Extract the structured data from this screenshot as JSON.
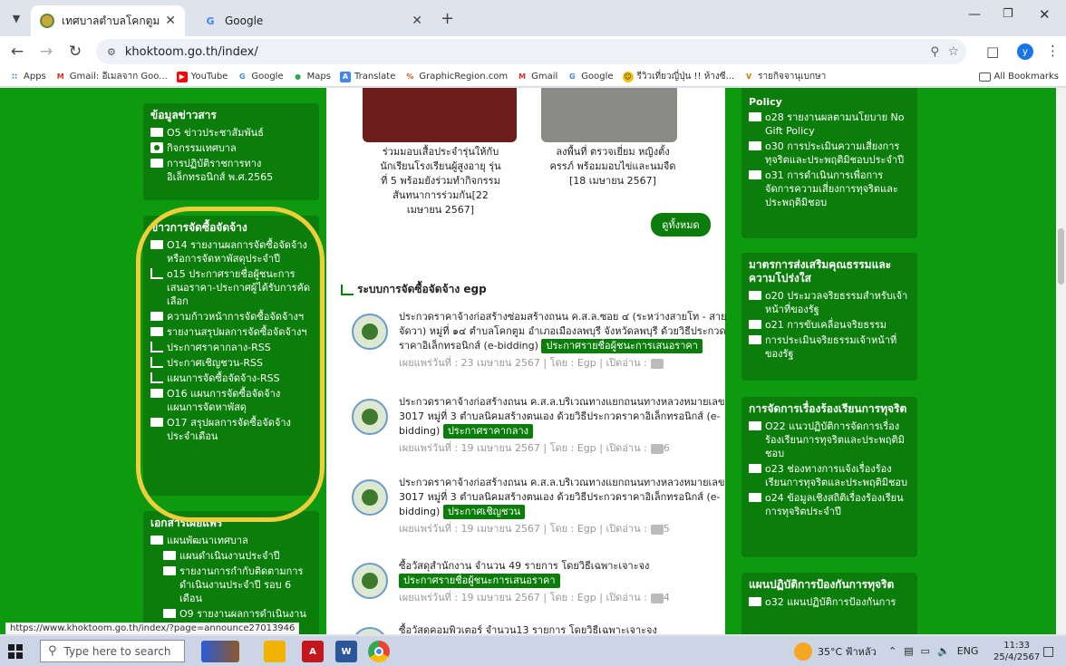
{
  "browser": {
    "tabs": [
      {
        "title": "เทศบาลตำบลโคกตูม อำเภอเมืองลพบ",
        "favicon": "site-seal-icon"
      },
      {
        "title": "Google",
        "favicon": "google-g-icon"
      }
    ],
    "url": "khoktoom.go.th/index/",
    "bookmarks": [
      {
        "label": "Apps",
        "icon": "apps-grid-icon"
      },
      {
        "label": "Gmail: อีเมลจาก Goo...",
        "icon": "gmail-icon"
      },
      {
        "label": "YouTube",
        "icon": "youtube-icon"
      },
      {
        "label": "Google",
        "icon": "google-g-icon"
      },
      {
        "label": "Maps",
        "icon": "maps-pin-icon"
      },
      {
        "label": "Translate",
        "icon": "translate-icon"
      },
      {
        "label": "GraphicRegion.com",
        "icon": "graphicregion-icon"
      },
      {
        "label": "Gmail",
        "icon": "gmail-icon"
      },
      {
        "label": "Google",
        "icon": "google-g-icon"
      },
      {
        "label": "รีวิวเที่ยวญี่ปุ่น !! ห้างซี...",
        "icon": "emoji-icon"
      },
      {
        "label": "รายกิจจานุเบกษา",
        "icon": "v-icon"
      }
    ],
    "all_bookmarks": "All Bookmarks"
  },
  "left_boxes": [
    {
      "title": "ข้อมูลข่าวสาร",
      "items": [
        {
          "icon": "folder-icon",
          "label": "O5 ข่าวประชาสัมพันธ์"
        },
        {
          "icon": "camera-icon",
          "label": "กิจกรรมเทศบาล"
        },
        {
          "icon": "folder-icon",
          "label": "การปฏิบัติราชการทางอิเล็กทรอนิกส์ พ.ศ.2565"
        }
      ]
    },
    {
      "title": "ข่าวการจัดซื้อจัดจ้าง",
      "items": [
        {
          "icon": "folder-icon",
          "label": "O14 รายงานผลการจัดซื้อจัดจ้างหรือการจัดหาพัสดุประจำปี"
        },
        {
          "icon": "rss-icon",
          "label": "o15 ประกาศรายชื่อผู้ชนะการเสนอราคา-ประกาศผู้ได้รับการคัดเลือก"
        },
        {
          "icon": "folder-icon",
          "label": "ความก้าวหน้าการจัดซื้อจัดจ้างฯ"
        },
        {
          "icon": "folder-icon",
          "label": "รายงานสรุปผลการจัดซื้อจัดจ้างฯ"
        },
        {
          "icon": "rss-icon",
          "label": "ประกาศราคากลาง-RSS"
        },
        {
          "icon": "rss-icon",
          "label": "ประกาศเชิญชวน-RSS"
        },
        {
          "icon": "rss-icon",
          "label": "แผนการจัดซื้อจัดจ้าง-RSS"
        },
        {
          "icon": "folder-icon",
          "label": "O16 แผนการจัดซื้อจัดจ้างแผนการจัดหาพัสดุ"
        },
        {
          "icon": "folder-icon",
          "label": "O17 สรุปผลการจัดซื้อจัดจ้างประจำเดือน"
        }
      ]
    },
    {
      "title": "เอกสารเผยแพร่",
      "items": [
        {
          "icon": "folder-icon",
          "label": "แผนพัฒนาเทศบาล",
          "indent": false
        },
        {
          "icon": "folder-icon",
          "label": "แผนดำเนินงานประจำปี",
          "indent": true
        },
        {
          "icon": "folder-icon",
          "label": "รายงานการกำกับติดตามการดำเนินงานประจำปี รอบ 6 เดือน",
          "indent": true
        },
        {
          "icon": "folder-icon",
          "label": "O9 รายงานผลการดำเนินงาน",
          "indent": false
        }
      ]
    }
  ],
  "news": [
    {
      "caption": "ร่วมมอบเสื้อประจำรุ่นให้กับนักเรียนโรงเรียนผู้สูงอายุ รุ่นที่ 5 พร้อมยังร่วมทำกิจกรรมสันทนาการร่วมกัน[22 เมษายน 2567]"
    },
    {
      "caption": "ลงพื้นที่ ตรวจเยี่ยม หญิงตั้งครรภ์ พร้อมมอบไข่และนมจืด [18 เมษายน 2567]"
    }
  ],
  "view_all": "ดูทั้งหมด",
  "egp": {
    "heading": "ระบบการจัดซื้อจัดจ้าง egp",
    "items": [
      {
        "title": "ประกวดราคาจ้างก่อสร้างซ่อมสร้างถนน ค.ส.ล.ซอย ๔ (ระหว่างสายโท - สายจัดวา) หมู่ที่ ๑๔ ตำบลโคกตูม อำเภอเมืองลพบุรี จังหวัดลพบุรี ด้วยวิธีประกวดราคาอิเล็กทรอนิกส์ (e-bidding)",
        "tag": "ประกาศรายชื่อผู้ชนะการเสนอราคา",
        "meta": "เผยแพร่วันที่ : 23 เมษายน 2567 | โดย : Egp | เปิดอ่าน :",
        "views": ""
      },
      {
        "title": "ประกวดราคาจ้างก่อสร้างถนน ค.ส.ล.บริเวณทางแยกถนนทางหลวงหมายเลข 3017 หมู่ที่ 3 ตำบลนิคมสร้างตนเอง ด้วยวิธีประกวดราคาอิเล็กทรอนิกส์ (e-bidding)",
        "tag": "ประกาศราคากลาง",
        "meta": "เผยแพร่วันที่ : 19 เมษายน 2567 | โดย : Egp | เปิดอ่าน :",
        "views": "6"
      },
      {
        "title": "ประกวดราคาจ้างก่อสร้างถนน ค.ส.ล.บริเวณทางแยกถนนทางหลวงหมายเลข 3017 หมู่ที่ 3 ตำบลนิคมสร้างตนเอง ด้วยวิธีประกวดราคาอิเล็กทรอนิกส์ (e-bidding)",
        "tag": "ประกาศเชิญชวน",
        "meta": "เผยแพร่วันที่ : 19 เมษายน 2567 | โดย : Egp | เปิดอ่าน :",
        "views": "5"
      },
      {
        "title": "ซื้อวัสดุสำนักงาน จำนวน 49 รายการ โดยวิธีเฉพาะเจาะจง",
        "tag": "ประกาศรายชื่อผู้ชนะการเสนอราคา",
        "meta": "เผยแพร่วันที่ : 19 เมษายน 2567 | โดย : Egp | เปิดอ่าน :",
        "views": "4"
      },
      {
        "title": "ซื้อวัสดุคอมพิวเตอร์ จำนวน13 รายการ โดยวิธีเฉพาะเจาะจง",
        "tag": "",
        "meta": "",
        "views": ""
      }
    ]
  },
  "right_boxes": [
    {
      "title": "",
      "items": [
        {
          "icon": "",
          "label": "Policy"
        },
        {
          "icon": "folder-icon",
          "label": "o28 รายงานผลตามนโยบาย No Gift Policy"
        },
        {
          "icon": "folder-icon",
          "label": "o30 การประเมินความเสี่ยงการทุจริตและประพฤติมิชอบประจำปี"
        },
        {
          "icon": "folder-icon",
          "label": "o31 การดำเนินการเพื่อการจัดการความเสี่ยงการทุจริตและประพฤติมิชอบ"
        }
      ]
    },
    {
      "title": "มาตรการส่งเสริมคุณธรรมและความโปร่งใส",
      "items": [
        {
          "icon": "folder-icon",
          "label": "o20 ประมวลจริยธรรมสำหรับเจ้าหน้าที่ของรัฐ"
        },
        {
          "icon": "folder-icon",
          "label": "o21 การขับเคลื่อนจริยธรรม"
        },
        {
          "icon": "folder-icon",
          "label": "การประเมินจริยธรรมเจ้าหน้าที่ของรัฐ"
        }
      ]
    },
    {
      "title": "การจัดการเรื่องร้องเรียนการทุจริต",
      "items": [
        {
          "icon": "folder-icon",
          "label": "O22 แนวปฏิบัติการจัดการเรื่องร้องเรียนการทุจริตและประพฤติมิชอบ"
        },
        {
          "icon": "folder-icon",
          "label": "o23 ช่องทางการแจ้งเรื่องร้องเรียนการทุจริตและประพฤติมิชอบ"
        },
        {
          "icon": "folder-icon",
          "label": "o24 ข้อมูลเชิงสถิติเรื่องร้องเรียนการทุจริตประจำปี"
        }
      ]
    },
    {
      "title": "แผนปฏิบัติการป้องกันการทุจริต",
      "items": [
        {
          "icon": "folder-icon",
          "label": "o32 แผนปฏิบัติการป้องกันการ"
        }
      ]
    }
  ],
  "status_url": "https://www.khoktoom.go.th/index/?page=announce27013946",
  "taskbar": {
    "search_placeholder": "Type here to search",
    "weather": "35°C ฟ้าหลัว",
    "lang": "ENG",
    "time": "11:33",
    "date": "25/4/2567"
  },
  "colors": {
    "page_green": "#0e9a0e",
    "box_green": "#0b7d0b",
    "highlight_yellow": "#f0cd3a",
    "messenger_blue": "#1e8dfb"
  }
}
